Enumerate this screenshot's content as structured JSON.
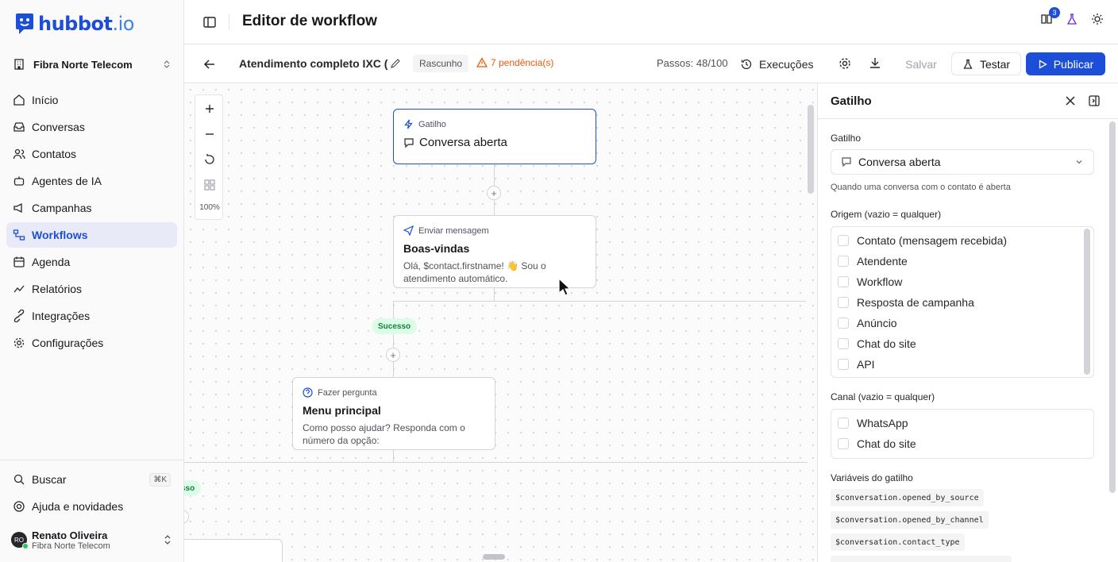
{
  "brand": {
    "name": "hubbot",
    "suffix": ".io"
  },
  "org": {
    "name": "Fibra Norte Telecom"
  },
  "nav": [
    {
      "label": "Início",
      "icon": "home-icon"
    },
    {
      "label": "Conversas",
      "icon": "inbox-icon"
    },
    {
      "label": "Contatos",
      "icon": "contacts-icon"
    },
    {
      "label": "Agentes de IA",
      "icon": "robot-icon"
    },
    {
      "label": "Campanhas",
      "icon": "megaphone-icon"
    },
    {
      "label": "Workflows",
      "icon": "workflow-icon",
      "active": true
    },
    {
      "label": "Agenda",
      "icon": "calendar-icon"
    },
    {
      "label": "Relatórios",
      "icon": "chart-icon"
    },
    {
      "label": "Integrações",
      "icon": "plug-icon"
    },
    {
      "label": "Configurações",
      "icon": "gear-icon"
    }
  ],
  "bottom": {
    "search": "Buscar",
    "search_kbd": "⌘K",
    "help": "Ajuda e novidades"
  },
  "user": {
    "initials": "RO",
    "name": "Renato Oliveira",
    "org": "Fibra Norte Telecom"
  },
  "header": {
    "title": "Editor de workflow",
    "notifications": "3"
  },
  "toolbar": {
    "workflow_name": "Atendimento completo IXC (",
    "status": "Rascunho",
    "pending": "7 pendência(s)",
    "steps": "Passos: 48/100",
    "executions": "Execuções",
    "save": "Salvar",
    "test": "Testar",
    "publish": "Publicar"
  },
  "canvas": {
    "zoom_level": "100%",
    "nodes": [
      {
        "type": "Gatilho",
        "title": "Conversa aberta",
        "desc": ""
      },
      {
        "type": "Enviar mensagem",
        "title": "Boas-vindas",
        "desc": "Olá, $contact.firstname! 👋 Sou o atendimento automático."
      },
      {
        "type": "Fazer pergunta",
        "title": "Menu principal",
        "desc": "Como posso ajudar? Responda com o número da opção:"
      }
    ],
    "edge_labels": [
      "Sucesso",
      "sso"
    ]
  },
  "panel": {
    "title": "Gatilho",
    "trigger_label": "Gatilho",
    "trigger_value": "Conversa aberta",
    "trigger_hint": "Quando uma conversa com o contato é aberta",
    "origin_label": "Origem (vazio = qualquer)",
    "origin_options": [
      "Contato (mensagem recebida)",
      "Atendente",
      "Workflow",
      "Resposta de campanha",
      "Anúncio",
      "Chat do site",
      "API"
    ],
    "channel_label": "Canal (vazio = qualquer)",
    "channel_options": [
      "WhatsApp",
      "Chat do site"
    ],
    "vars_label": "Variáveis do gatilho",
    "vars": [
      "$conversation.opened_by_source",
      "$conversation.opened_by_channel",
      "$conversation.contact_type"
    ]
  },
  "colors": {
    "accent": "#1d4ed8",
    "warning": "#ea580c",
    "success_bg": "#dcfce7",
    "success_fg": "#15803d"
  }
}
